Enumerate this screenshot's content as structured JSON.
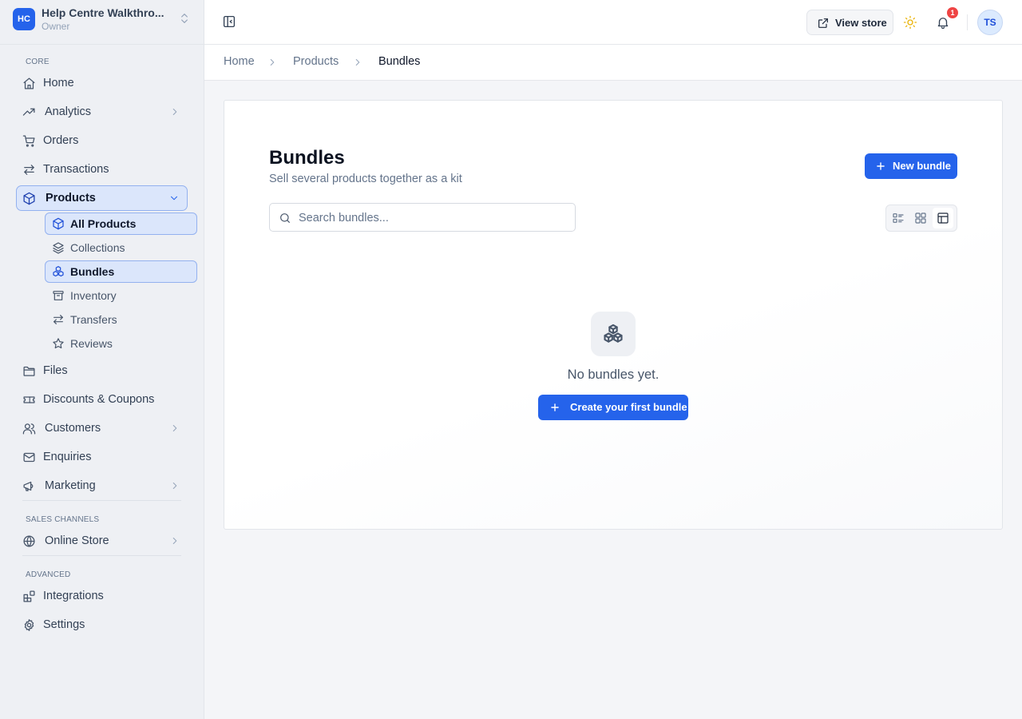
{
  "brand": {
    "initials": "HC",
    "name": "Help Centre Walkthro...",
    "role": "Owner"
  },
  "sidebar": {
    "sections": {
      "core": "CORE",
      "sales": "SALES CHANNELS",
      "advanced": "ADVANCED"
    },
    "items": {
      "home": "Home",
      "analytics": "Analytics",
      "orders": "Orders",
      "transactions": "Transactions",
      "products": "Products",
      "files": "Files",
      "discounts": "Discounts & Coupons",
      "customers": "Customers",
      "enquiries": "Enquiries",
      "marketing": "Marketing",
      "online_store": "Online Store",
      "integrations": "Integrations",
      "settings": "Settings"
    },
    "products_sub": {
      "all_products": "All Products",
      "collections": "Collections",
      "bundles": "Bundles",
      "inventory": "Inventory",
      "transfers": "Transfers",
      "reviews": "Reviews"
    }
  },
  "topbar": {
    "view_store": "View store",
    "notification_count": "1",
    "avatar": "TS"
  },
  "breadcrumb": [
    "Home",
    "Products",
    "Bundles"
  ],
  "page": {
    "title": "Bundles",
    "subtitle": "Sell several products together as a kit",
    "new_button": "New bundle",
    "search_placeholder": "Search bundles...",
    "view_modes": [
      "list",
      "grid",
      "table"
    ],
    "active_view": "table",
    "empty_text": "No bundles yet.",
    "empty_cta": "Create your first bundle"
  },
  "colors": {
    "accent": "#2563eb",
    "badge": "#ef4444",
    "active_bg": "#dbe6fb"
  },
  "icons": {
    "brand_switch": "chevrons-up-down-icon",
    "sidebar_toggle": "panel-left-icon",
    "view_store": "external-link-icon",
    "theme": "sun-icon",
    "notifications": "bell-icon",
    "search": "search-icon",
    "empty": "boxes-icon"
  }
}
